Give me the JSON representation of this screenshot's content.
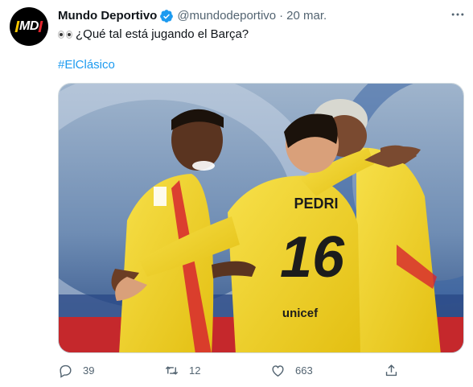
{
  "tweet": {
    "author_name": "Mundo Deportivo",
    "handle": "@mundodeportivo",
    "separator": "·",
    "time": "20 mar.",
    "text": "¿Qué tal está jugando el Barça?",
    "hashtag": "#ElClásico",
    "avatar_logo_text": "MD",
    "media": {
      "player_name": "PEDRI",
      "player_number": "16",
      "sponsor": "unicef"
    },
    "actions": {
      "replies": "39",
      "retweets": "12",
      "likes": "663"
    }
  },
  "colors": {
    "link": "#1d9bf0",
    "secondary_text": "#536471",
    "verified": "#1d9bf0",
    "kit_yellow": "#f4d81f",
    "kit_red": "#d7262f"
  },
  "icons": [
    "verified-badge-icon",
    "more-icon",
    "reply-icon",
    "retweet-icon",
    "like-icon",
    "share-icon",
    "eyes-emoji-icon"
  ]
}
